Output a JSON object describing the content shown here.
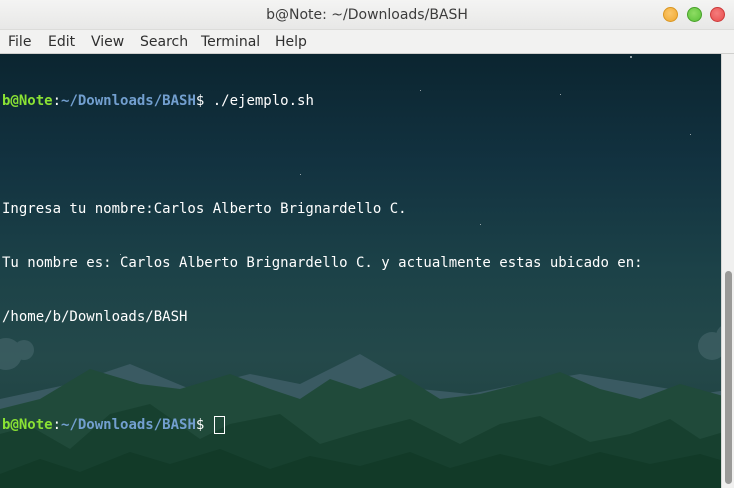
{
  "window": {
    "title": "b@Note: ~/Downloads/BASH"
  },
  "menu": [
    "File",
    "Edit",
    "View",
    "Search",
    "Terminal",
    "Help"
  ],
  "terminal": {
    "prompt_user": "b@Note",
    "prompt_sep": ":",
    "prompt_path": "~/Downloads/BASH",
    "prompt_symbol": "$ ",
    "command": "./ejemplo.sh",
    "output": [
      "Ingresa tu nombre:Carlos Alberto Brignardello C.",
      "Tu nombre es: Carlos Alberto Brignardello C. y actualmente estas ubicado en:",
      "/home/b/Downloads/BASH"
    ]
  },
  "colors": {
    "prompt_user": "#8ae234",
    "prompt_path": "#729fcf",
    "text": "#ffffff"
  }
}
